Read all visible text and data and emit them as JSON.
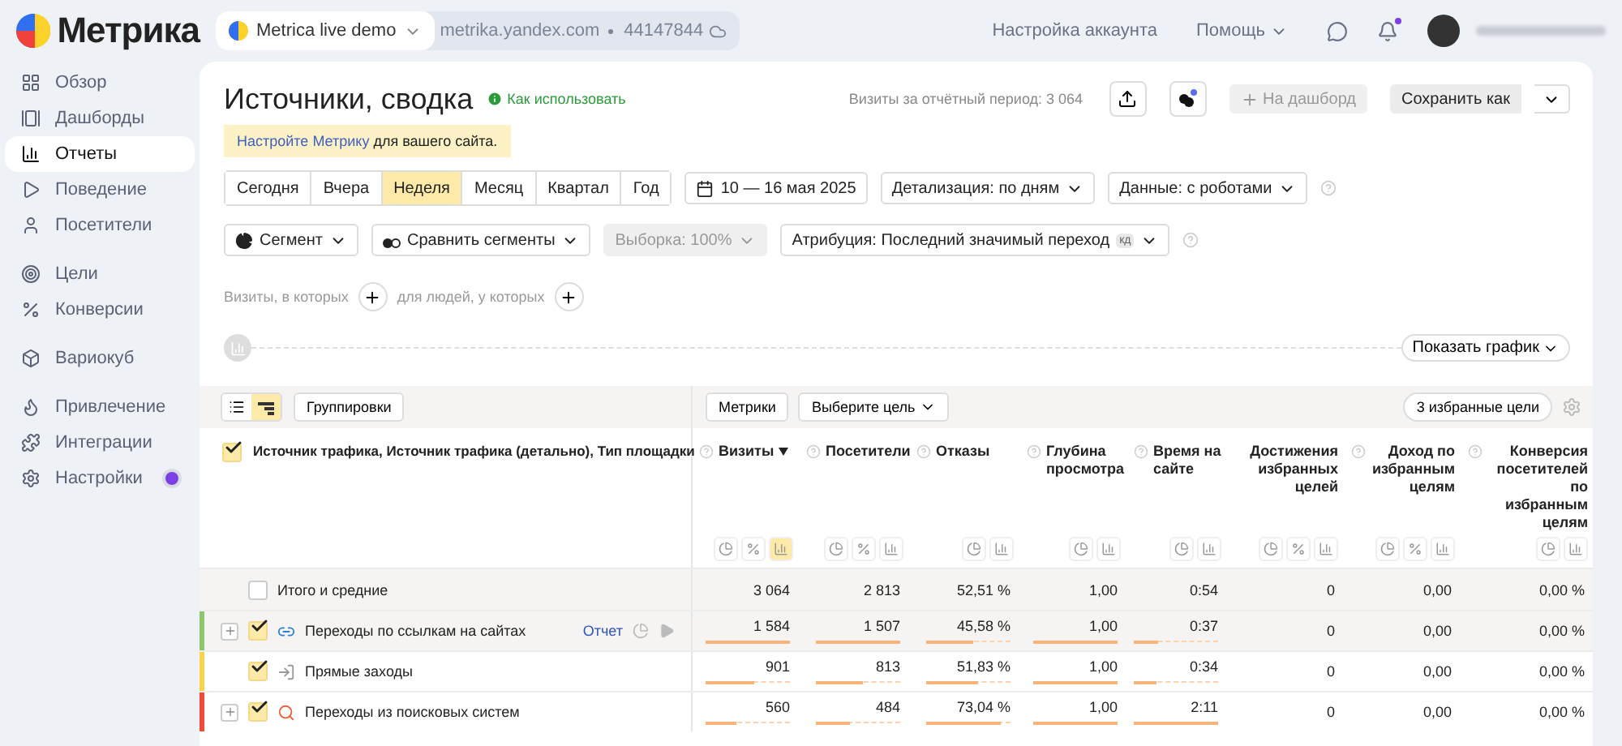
{
  "header": {
    "logo": "Метрика",
    "counter": {
      "name": "Metrica live demo",
      "domain": "metrika.yandex.com",
      "id": "44147844"
    },
    "links": [
      "Настройка аккаунта",
      "Помощь"
    ],
    "notifications_unread": true
  },
  "sidebar": {
    "groups": [
      [
        {
          "label": "Обзор",
          "selected": false,
          "badge": false
        },
        {
          "label": "Дашборды",
          "selected": false,
          "badge": false
        },
        {
          "label": "Отчеты",
          "selected": true,
          "badge": false
        },
        {
          "label": "Поведение",
          "selected": false,
          "badge": false
        },
        {
          "label": "Посетители",
          "selected": false,
          "badge": false
        }
      ],
      [
        {
          "label": "Цели",
          "selected": false,
          "badge": false
        },
        {
          "label": "Конверсии",
          "selected": false,
          "badge": false
        }
      ],
      [
        {
          "label": "Вариокуб",
          "selected": false,
          "badge": false
        }
      ],
      [
        {
          "label": "Привлечение",
          "selected": false,
          "badge": false
        },
        {
          "label": "Интеграции",
          "selected": false,
          "badge": false
        },
        {
          "label": "Настройки",
          "selected": false,
          "badge": true
        }
      ]
    ]
  },
  "report": {
    "title": "Источники, сводка",
    "help_link": "Как использовать",
    "visits_total": "Визиты за отчётный период: 3 064",
    "dashboard_button": "На дашборд",
    "save_button": "Сохранить как",
    "notice": {
      "link": "Настройте Метрику",
      "text": "для вашего сайта."
    },
    "periods": [
      {
        "label": "Сегодня",
        "selected": false
      },
      {
        "label": "Вчера",
        "selected": false
      },
      {
        "label": "Неделя",
        "selected": true
      },
      {
        "label": "Месяц",
        "selected": false
      },
      {
        "label": "Квартал",
        "selected": false
      },
      {
        "label": "Год",
        "selected": false
      }
    ],
    "date_range": "10 — 16 мая 2025",
    "selects": [
      "Детализация: по дням",
      "Данные: с роботами"
    ],
    "segment": "Сегмент",
    "compare": "Сравнить сегменты",
    "sample": {
      "label": "Выборка: 100%",
      "disabled": true
    },
    "attribution": {
      "label": "Атрибуция: Последний значимый переход",
      "tag": "кд"
    },
    "conditions": [
      "Визиты, в которых",
      "для людей, у которых"
    ],
    "chart_toggle": "Показать график"
  },
  "table": {
    "view_modes": [
      {
        "kind": "list",
        "selected": false
      },
      {
        "kind": "tree",
        "selected": true
      }
    ],
    "groupings": "Группировки",
    "metrics": "Метрики",
    "goal": "Выберите цель",
    "favorites": "3 избранные цели",
    "dimension_header": {
      "label": "Источник трафика, Источник трафика (детально), Тип площадки",
      "checked": true
    },
    "columns": [
      {
        "label": "Визиты",
        "help": true,
        "sorted": true,
        "views": [
          {
            "kind": "pie",
            "selected": false
          },
          {
            "kind": "percent",
            "selected": false
          },
          {
            "kind": "bars",
            "selected": true
          }
        ]
      },
      {
        "label": "Посетители",
        "help": true,
        "sorted": false,
        "views": [
          {
            "kind": "pie",
            "selected": false
          },
          {
            "kind": "percent",
            "selected": false
          },
          {
            "kind": "bars",
            "selected": false
          }
        ]
      },
      {
        "label": "Отказы",
        "help": true,
        "sorted": false,
        "views": [
          {
            "kind": "pie",
            "selected": false
          },
          {
            "kind": "bars",
            "selected": false
          }
        ]
      },
      {
        "label": "Глубина просмотра",
        "help": true,
        "sorted": false,
        "views": [
          {
            "kind": "pie",
            "selected": false
          },
          {
            "kind": "bars",
            "selected": false
          }
        ]
      },
      {
        "label": "Время на сайте",
        "help": true,
        "sorted": false,
        "views": [
          {
            "kind": "pie",
            "selected": false
          },
          {
            "kind": "bars",
            "selected": false
          }
        ]
      },
      {
        "label": "Достижения избранных целей",
        "help": false,
        "sorted": false,
        "views": [
          {
            "kind": "pie",
            "selected": false
          },
          {
            "kind": "percent",
            "selected": false
          },
          {
            "kind": "bars",
            "selected": false
          }
        ]
      },
      {
        "label": "Доход по избранным целям",
        "help": true,
        "sorted": false,
        "views": [
          {
            "kind": "pie",
            "selected": false
          },
          {
            "kind": "percent",
            "selected": false
          },
          {
            "kind": "bars",
            "selected": false
          }
        ]
      },
      {
        "label": "Конверсия посетителей по избранным целям",
        "help": true,
        "sorted": false,
        "views": [
          {
            "kind": "pie",
            "selected": false
          },
          {
            "kind": "bars",
            "selected": false
          }
        ]
      }
    ],
    "rows": [
      {
        "label": "Итого и средние",
        "kind": "total",
        "checked": false,
        "expandable": false,
        "highlighted": true,
        "values": [
          {
            "text": "3 064"
          },
          {
            "text": "2 813"
          },
          {
            "text": "52,51 %"
          },
          {
            "text": "1,00"
          },
          {
            "text": "0:54"
          },
          {
            "text": "0"
          },
          {
            "text": "0,00"
          },
          {
            "text": "0,00 %"
          }
        ]
      },
      {
        "label": "Переходы по ссылкам на сайтах",
        "kind": "links",
        "color": "#8cc76e",
        "checked": true,
        "expandable": true,
        "highlighted": true,
        "report_link": "Отчет",
        "values": [
          {
            "text": "1 584",
            "level": 1
          },
          {
            "text": "1 507",
            "level": 1
          },
          {
            "text": "45,58 %",
            "level": 0.55
          },
          {
            "text": "1,00",
            "level": 1
          },
          {
            "text": "0:37",
            "level": 0.28
          },
          {
            "text": "0"
          },
          {
            "text": "0,00"
          },
          {
            "text": "0,00 %"
          }
        ]
      },
      {
        "label": "Прямые заходы",
        "kind": "direct",
        "color": "#f6d44c",
        "checked": true,
        "expandable": false,
        "highlighted": false,
        "values": [
          {
            "text": "901",
            "level": 0.58
          },
          {
            "text": "813",
            "level": 0.55
          },
          {
            "text": "51,83 %",
            "level": 0.62
          },
          {
            "text": "1,00",
            "level": 1
          },
          {
            "text": "0:34",
            "level": 0.26
          },
          {
            "text": "0"
          },
          {
            "text": "0,00"
          },
          {
            "text": "0,00 %"
          }
        ]
      },
      {
        "label": "Переходы из поисковых систем",
        "kind": "search",
        "color": "#f04a3a",
        "checked": true,
        "expandable": true,
        "highlighted": false,
        "values": [
          {
            "text": "560",
            "level": 0.36
          },
          {
            "text": "484",
            "level": 0.4
          },
          {
            "text": "73,04 %",
            "level": 0.88
          },
          {
            "text": "1,00",
            "level": 1
          },
          {
            "text": "2:11",
            "level": 1
          },
          {
            "text": "0"
          },
          {
            "text": "0,00"
          },
          {
            "text": "0,00 %"
          }
        ]
      }
    ]
  }
}
